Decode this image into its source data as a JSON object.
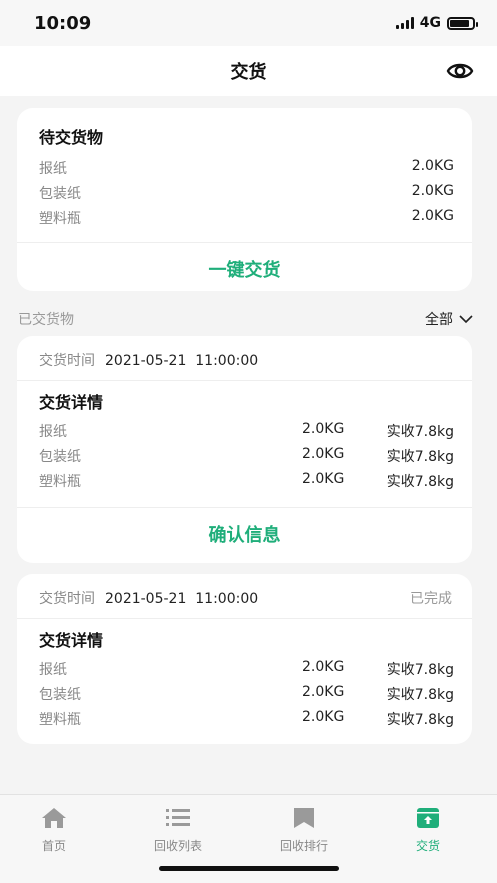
{
  "status_bar": {
    "time": "10:09",
    "network": "4G",
    "battery_level": 0.85
  },
  "header": {
    "title": "交货",
    "right_icon": "eye-icon"
  },
  "pending": {
    "title": "待交货物",
    "items": [
      {
        "name": "报纸",
        "weight": "2.0KG"
      },
      {
        "name": "包装纸",
        "weight": "2.0KG"
      },
      {
        "name": "塑料瓶",
        "weight": "2.0KG"
      }
    ],
    "action_label": "一键交货"
  },
  "delivered": {
    "section_label": "已交货物",
    "filter_label": "全部",
    "records": [
      {
        "time_label": "交货时间",
        "time_value": "2021-05-21  11:00:00",
        "status": "",
        "detail_title": "交货详情",
        "items": [
          {
            "name": "报纸",
            "weight": "2.0KG",
            "actual": "实收7.8kg"
          },
          {
            "name": "包装纸",
            "weight": "2.0KG",
            "actual": "实收7.8kg"
          },
          {
            "name": "塑料瓶",
            "weight": "2.0KG",
            "actual": "实收7.8kg"
          }
        ],
        "action_label": "确认信息"
      },
      {
        "time_label": "交货时间",
        "time_value": "2021-05-21  11:00:00",
        "status": "已完成",
        "detail_title": "交货详情",
        "items": [
          {
            "name": "报纸",
            "weight": "2.0KG",
            "actual": "实收7.8kg"
          },
          {
            "name": "包装纸",
            "weight": "2.0KG",
            "actual": "实收7.8kg"
          },
          {
            "name": "塑料瓶",
            "weight": "2.0KG",
            "actual": "实收7.8kg"
          }
        ]
      }
    ]
  },
  "tabbar": {
    "tabs": [
      {
        "label": "首页",
        "icon": "home-icon"
      },
      {
        "label": "回收列表",
        "icon": "list-icon"
      },
      {
        "label": "回收排行",
        "icon": "bookmark-icon"
      },
      {
        "label": "交货",
        "icon": "delivery-box-icon",
        "active": true
      }
    ]
  },
  "colors": {
    "accent": "#1fae7a",
    "background": "#f4f4f4",
    "card": "#ffffff"
  }
}
